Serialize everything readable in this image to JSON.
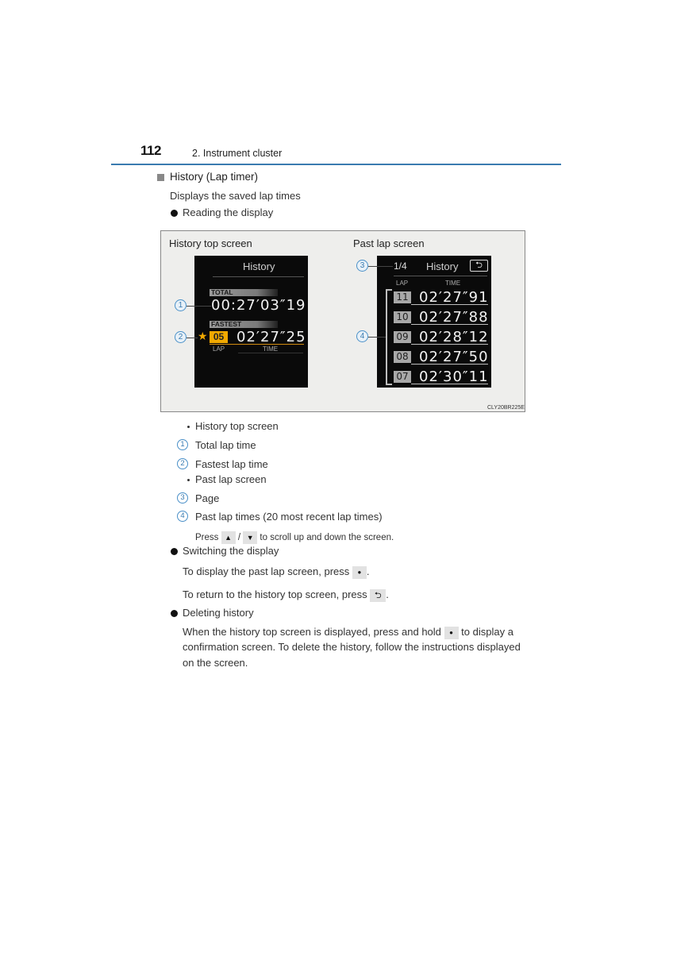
{
  "header": {
    "page_number": "112",
    "chapter": "2. Instrument cluster"
  },
  "section": {
    "title": "History (Lap timer)",
    "intro": "Displays the saved lap times",
    "reading_bullet": "Reading the display"
  },
  "figure": {
    "left_label": "History top screen",
    "right_label": "Past lap screen",
    "code": "CLY20BR225E",
    "history_top": {
      "title": "History",
      "total_label": "TOTAL",
      "total_time": "00:27′03″19",
      "fastest_label": "FASTEST",
      "fastest_lap": "05",
      "fastest_time": "02′27″25",
      "lap_caption": "LAP",
      "time_caption": "TIME",
      "star_icon": "★"
    },
    "past_lap": {
      "page": "1/4",
      "title": "History",
      "back_icon": "⮌",
      "lap_header": "LAP",
      "time_header": "TIME",
      "rows": [
        {
          "lap": "11",
          "time": "02′27″91"
        },
        {
          "lap": "10",
          "time": "02′27″88"
        },
        {
          "lap": "09",
          "time": "02′28″12"
        },
        {
          "lap": "08",
          "time": "02′27″50"
        },
        {
          "lap": "07",
          "time": "02′30″11"
        }
      ]
    },
    "callouts": [
      "1",
      "2",
      "3",
      "4"
    ]
  },
  "legend": {
    "group1": "History top screen",
    "item1": {
      "num": "1",
      "text": "Total lap time"
    },
    "item2": {
      "num": "2",
      "text": "Fastest lap time"
    },
    "group2": "Past lap screen",
    "item3": {
      "num": "3",
      "text": "Page"
    },
    "item4": {
      "num": "4",
      "text": "Past lap times (20 most recent lap times)"
    },
    "scroll_note": {
      "prefix": "Press",
      "up_icon": "▲",
      "separator": "/",
      "down_icon": "▼",
      "suffix": "to scroll up and down the screen."
    }
  },
  "switching": {
    "bullet": "Switching the display",
    "line1_prefix": "To display the past lap screen, press",
    "line1_icon": "●",
    "line1_suffix": ".",
    "line2_prefix": "To return to the history top screen, press",
    "line2_icon": "⮌",
    "line2_suffix": "."
  },
  "deleting": {
    "bullet": "Deleting history",
    "line1_prefix": "When the history top screen is displayed, press and hold",
    "line1_icon": "●",
    "line1_suffix": "to display a",
    "line2": "confirmation screen. To delete the history, follow the instructions displayed",
    "line3": "on the screen."
  },
  "colors": {
    "accent_blue": "#3a7bb0",
    "orange": "#f2a900"
  }
}
